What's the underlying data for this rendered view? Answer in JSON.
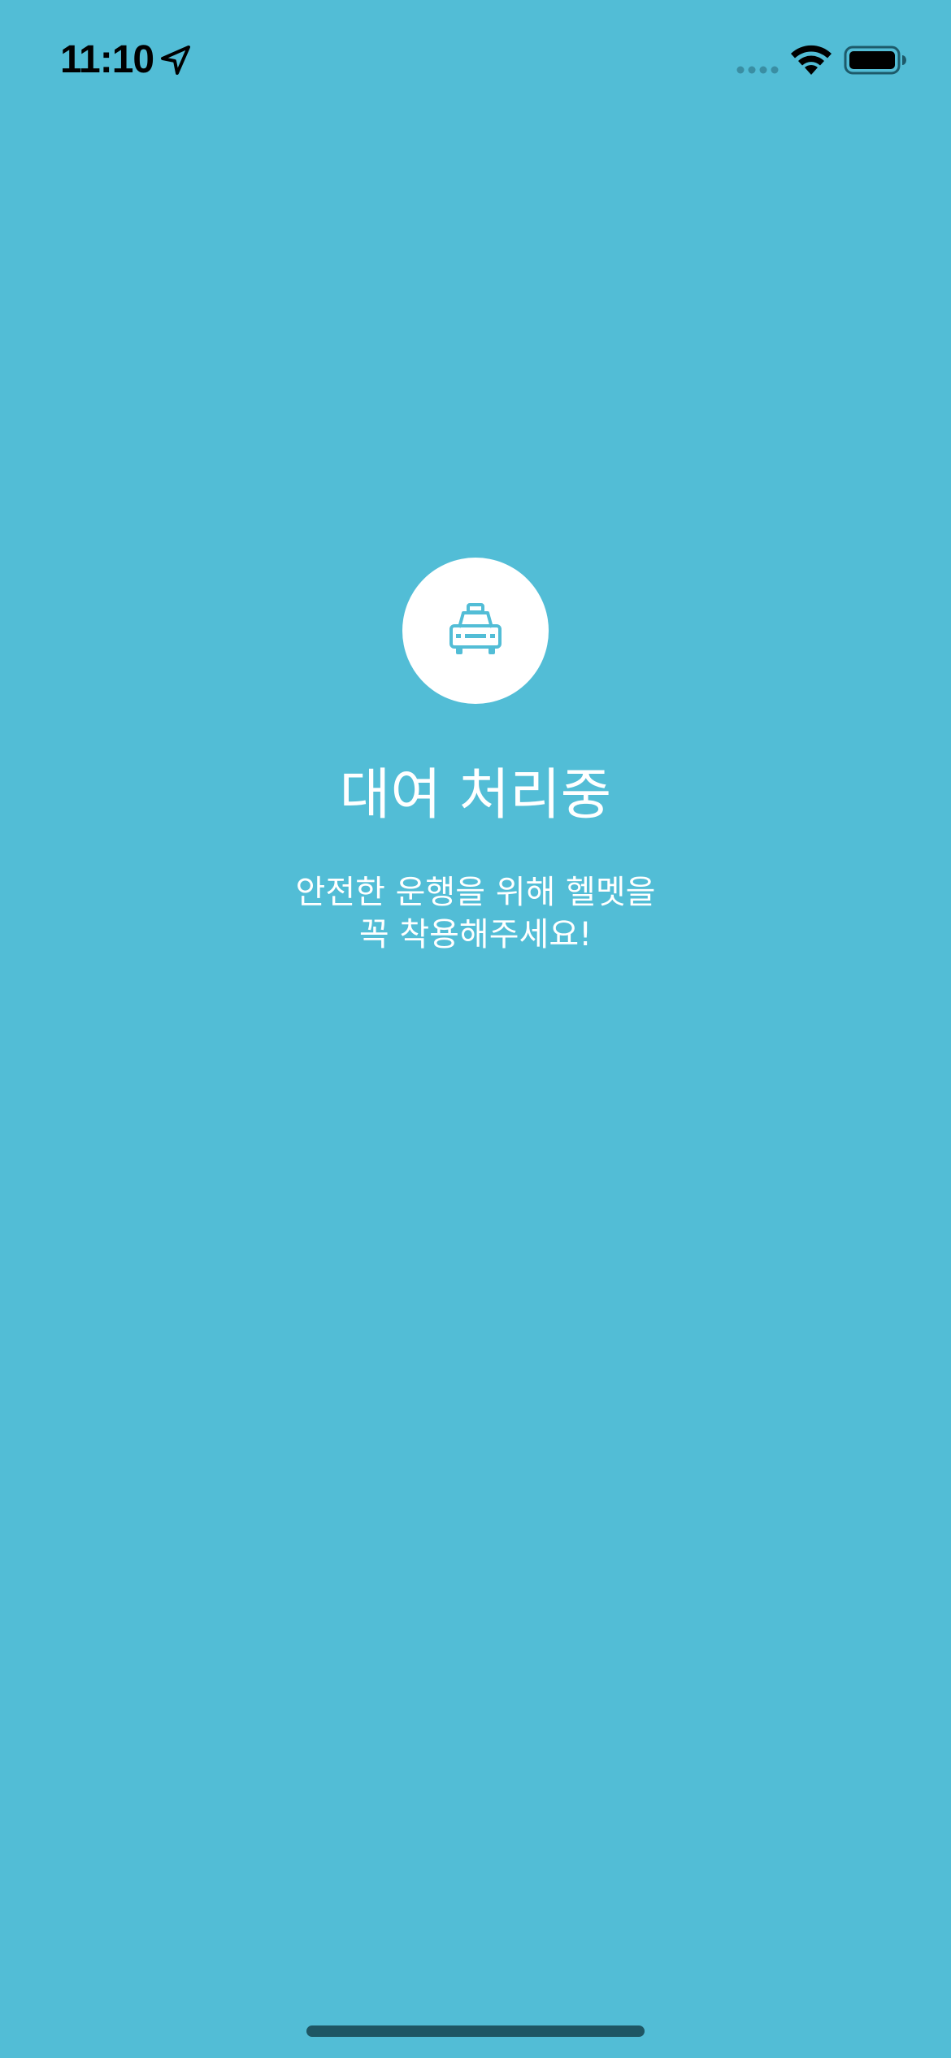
{
  "status_bar": {
    "time": "11:10",
    "icons": {
      "location": "location-arrow-icon",
      "cellular": "cellular-signal-icon",
      "wifi": "wifi-icon",
      "battery": "battery-icon"
    }
  },
  "main": {
    "icon": "taxi-icon",
    "title": "대여 처리중",
    "subtitle_line1": "안전한 운행을 위해 헬멧을",
    "subtitle_line2": "꼭 착용해주세요!"
  },
  "colors": {
    "background": "#52BDD6",
    "text": "#FFFFFF",
    "icon_circle": "#FFFFFF",
    "icon_glyph": "#52BDD6"
  }
}
